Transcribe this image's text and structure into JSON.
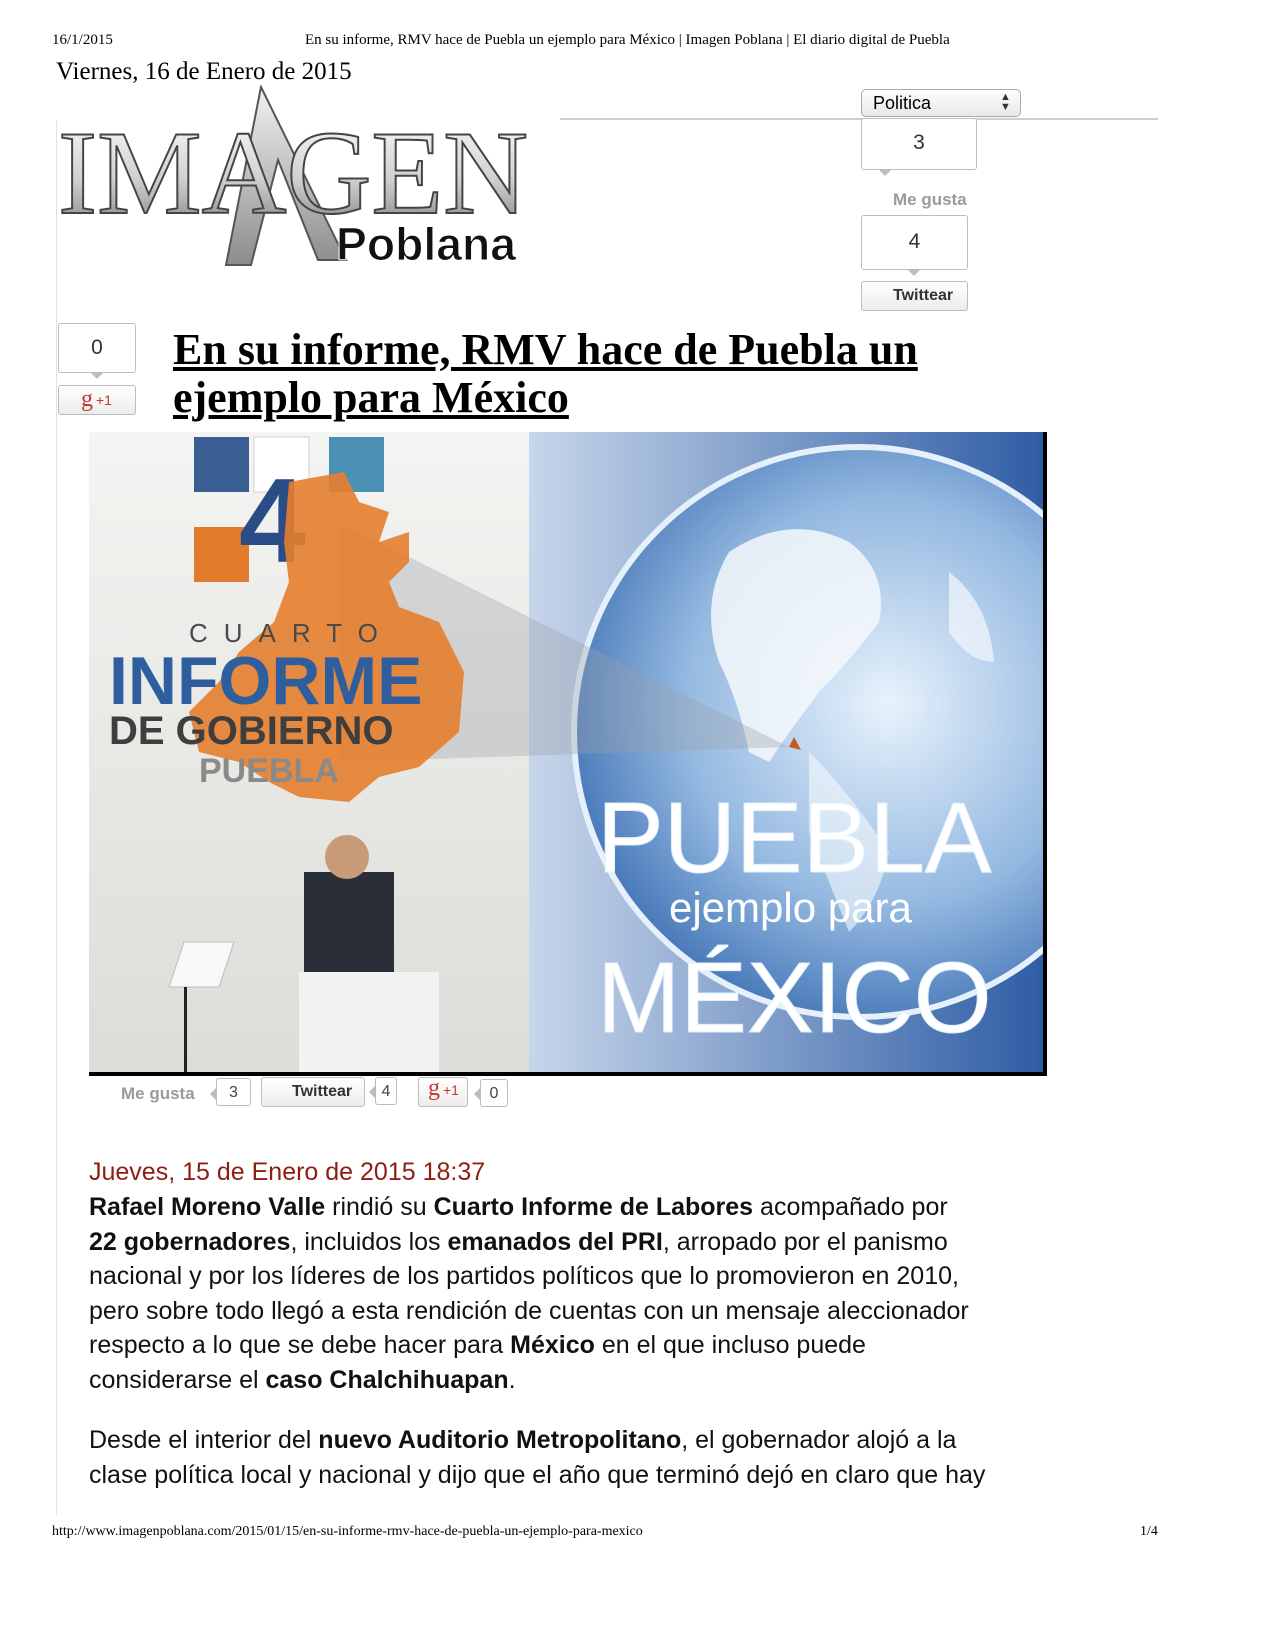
{
  "print_header": {
    "date": "16/1/2015",
    "page_title": "En su informe, RMV hace de Puebla un ejemplo para México | Imagen Poblana | El diario digital de Puebla"
  },
  "print_footer": {
    "url": "http://www.imagenpoblana.com/2015/01/15/en-su-informe-rmv-hace-de-puebla-un-ejemplo-para-mexico",
    "page_number": "1/4"
  },
  "site": {
    "current_date": "Viernes, 16 de Enero de 2015",
    "logo_main": "IMAGEN",
    "logo_sub": "Poblana"
  },
  "section_select": {
    "selected": "Politica"
  },
  "side_social": {
    "facebook_count": "3",
    "facebook_label": "Me gusta",
    "twitter_count": "4",
    "twitter_label": "Twittear",
    "gplus_count": "0",
    "gplus_label": "+1"
  },
  "article": {
    "title_line1": "En su informe, RMV hace de Puebla un",
    "title_line2": "ejemplo para México",
    "image": {
      "label_cuarto": "CUARTO",
      "label_informe": "INFORME",
      "label_de_gobierno": "DE GOBIERNO",
      "label_puebla_small": "PUEBLA",
      "big_number": "4",
      "headline_puebla": "PUEBLA",
      "headline_ejemplo": "ejemplo para",
      "headline_mexico": "MÉXICO"
    },
    "share_bar": {
      "fb_label": "Me gusta",
      "fb_count": "3",
      "tw_label": "Twittear",
      "tw_count": "4",
      "gp_label": "+1",
      "gp_count": "0"
    },
    "dateline": "Jueves, 15 de Enero de 2015 18:37",
    "p1": {
      "a": "Rafael Moreno Valle",
      "b": " rindió su ",
      "c": "Cuarto Informe de Labores",
      "d": " acompañado por",
      "e": "22 gobernadores",
      "f": ", incluidos los ",
      "g": "emanados del PRI",
      "h": ", arropado por el panismo",
      "i": "nacional y por los líderes de los partidos políticos que lo promovieron en 2010,",
      "j": "pero sobre todo llegó a esta rendición de cuentas con un mensaje aleccionador",
      "k": "respecto a lo que se debe hacer para ",
      "l": "México",
      "m": " en el que incluso puede",
      "n": "considerarse el ",
      "o": "caso Chalchihuapan",
      "p": "."
    },
    "p2": {
      "a": "Desde el interior del ",
      "b": "nuevo Auditorio Metropolitano",
      "c": ", el gobernador alojó a la",
      "d": "clase política local y nacional y dijo que el año que terminó dejó en claro que hay"
    }
  }
}
